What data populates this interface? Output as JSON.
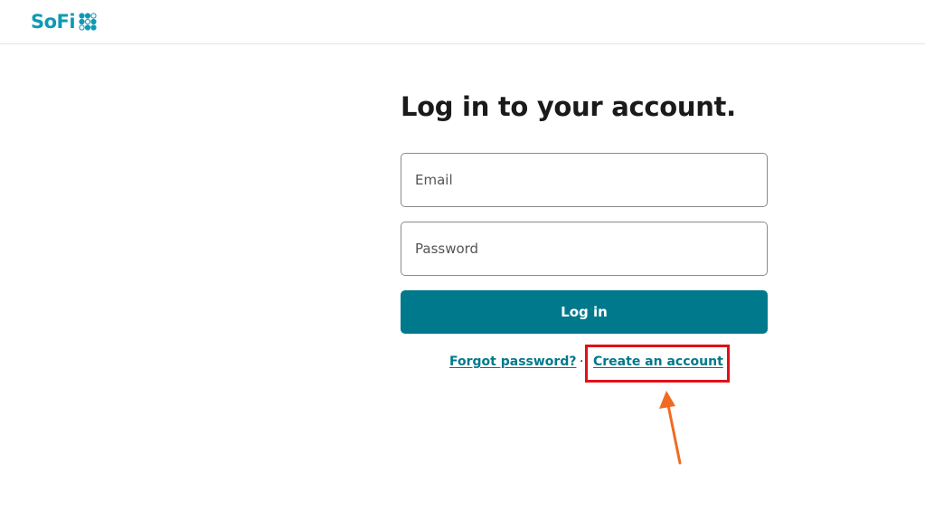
{
  "header": {
    "logo_text": "SoFi"
  },
  "login": {
    "title": "Log in to your account.",
    "email_placeholder": "Email",
    "password_placeholder": "Password",
    "login_button_label": "Log in",
    "forgot_password_label": "Forgot password?",
    "separator": "·",
    "create_account_label": "Create an account"
  },
  "colors": {
    "brand": "#0d9ab5",
    "button": "#00798c",
    "link": "#00798c",
    "highlight": "#e0101a",
    "arrow": "#f26a21"
  },
  "annotation": {
    "highlight_icon": "highlight-box",
    "arrow_icon": "arrow-up-icon"
  }
}
